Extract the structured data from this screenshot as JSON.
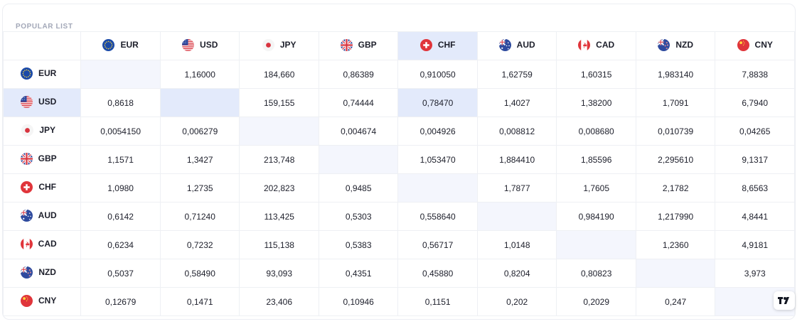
{
  "title": "POPULAR LIST",
  "currencies": [
    {
      "code": "EUR",
      "flag": "eu-flag"
    },
    {
      "code": "USD",
      "flag": "us-flag"
    },
    {
      "code": "JPY",
      "flag": "jp-flag"
    },
    {
      "code": "GBP",
      "flag": "gb-flag"
    },
    {
      "code": "CHF",
      "flag": "ch-flag"
    },
    {
      "code": "AUD",
      "flag": "au-flag"
    },
    {
      "code": "CAD",
      "flag": "ca-flag"
    },
    {
      "code": "NZD",
      "flag": "nz-flag"
    },
    {
      "code": "CNY",
      "flag": "cn-flag"
    }
  ],
  "rows": [
    [
      "",
      "1,16000",
      "184,660",
      "0,86389",
      "0,910050",
      "1,62759",
      "1,60315",
      "1,983140",
      "7,8838"
    ],
    [
      "0,8618",
      "",
      "159,155",
      "0,74444",
      "0,78470",
      "1,4027",
      "1,38200",
      "1,7091",
      "6,7940"
    ],
    [
      "0,0054150",
      "0,006279",
      "",
      "0,004674",
      "0,004926",
      "0,008812",
      "0,008680",
      "0,010739",
      "0,04265"
    ],
    [
      "1,1571",
      "1,3427",
      "213,748",
      "",
      "1,053470",
      "1,884410",
      "1,85596",
      "2,295610",
      "9,1317"
    ],
    [
      "1,0980",
      "1,2735",
      "202,823",
      "0,9485",
      "",
      "1,7877",
      "1,7605",
      "2,1782",
      "8,6563"
    ],
    [
      "0,6142",
      "0,71240",
      "113,425",
      "0,5303",
      "0,558640",
      "",
      "0,984190",
      "1,217990",
      "4,8441"
    ],
    [
      "0,6234",
      "0,7232",
      "115,138",
      "0,5383",
      "0,56717",
      "1,0148",
      "",
      "1,2360",
      "4,9181"
    ],
    [
      "0,5037",
      "0,58490",
      "93,093",
      "0,4351",
      "0,45880",
      "0,8204",
      "0,80823",
      "",
      "3,973"
    ],
    [
      "0,12679",
      "0,1471",
      "23,406",
      "0,10946",
      "0,1151",
      "0,202",
      "0,2029",
      "0,247",
      ""
    ]
  ],
  "highlight": {
    "row_code": "USD",
    "col_code": "CHF"
  },
  "colors": {
    "diagonal": "#f4f6fd",
    "highlight": "#e3eafb",
    "border": "#eef0f4"
  },
  "widget_logo": "tradingview-logo-icon"
}
